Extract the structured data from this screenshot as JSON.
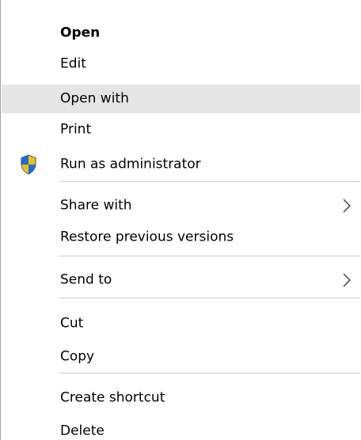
{
  "context_menu": {
    "items": [
      {
        "label": "Open"
      },
      {
        "label": "Edit"
      },
      {
        "label": "Open with"
      },
      {
        "label": "Print"
      },
      {
        "label": "Run as administrator",
        "icon": "uac-shield-icon"
      },
      {
        "label": "Share with",
        "icon": "chevron-right-icon"
      },
      {
        "label": "Restore previous versions"
      },
      {
        "label": "Send to",
        "icon": "chevron-right-icon"
      },
      {
        "label": "Cut"
      },
      {
        "label": "Copy"
      },
      {
        "label": "Create shortcut"
      },
      {
        "label": "Delete"
      }
    ],
    "highlighted_item": "Open with",
    "default_item": "Open",
    "colors": {
      "background": "#ffffff",
      "hover": "#e5e5e5",
      "separator": "#cccccc",
      "border": "#a0a0a0",
      "shield_blue": "#1e6fd0",
      "shield_yellow": "#f5c016"
    }
  }
}
